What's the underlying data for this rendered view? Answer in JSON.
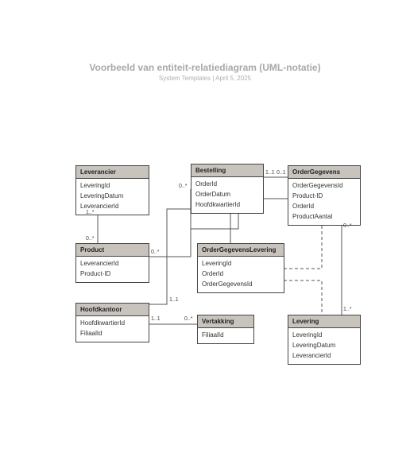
{
  "title": "Voorbeeld van entiteit-relatiediagram (UML-notatie)",
  "subtitle": "System Templates  |  April 5, 2025",
  "entities": {
    "leverancier": {
      "name": "Leverancier",
      "attrs": [
        "LeveringId",
        "LeveringDatum",
        "LeverancierId"
      ]
    },
    "bestelling": {
      "name": "Bestelling",
      "attrs": [
        "OrderId",
        "OrderDatum",
        "HoofdkwartierId"
      ]
    },
    "ordergegevens": {
      "name": "OrderGegevens",
      "attrs": [
        "OrderGegevensId",
        "Product-ID",
        "OrderId",
        "ProductAantal"
      ]
    },
    "product": {
      "name": "Product",
      "attrs": [
        "LeverancierId",
        "Product-ID"
      ]
    },
    "ogl": {
      "name": "OrderGegevensLevering",
      "attrs": [
        "LeveringId",
        "OrderId",
        "OrderGegevensId"
      ]
    },
    "hoofdkantoor": {
      "name": "Hoofdkantoor",
      "attrs": [
        "HoofdkwartierId",
        "FiliaalId"
      ]
    },
    "vertakking": {
      "name": "Vertakking",
      "attrs": [
        "FiliaalId"
      ]
    },
    "levering": {
      "name": "Levering",
      "attrs": [
        "LeveringId",
        "LeveringDatum",
        "LeverancierId"
      ]
    }
  },
  "mults": {
    "m1": "1..*",
    "m2": "0..*",
    "m3": "0..*",
    "m4": "0..*",
    "m5": "1..1",
    "m6": "0..1",
    "m7": "0..*",
    "m8": "1..1",
    "m9": "1..1",
    "m10": "0..*",
    "m11": "1..*"
  }
}
